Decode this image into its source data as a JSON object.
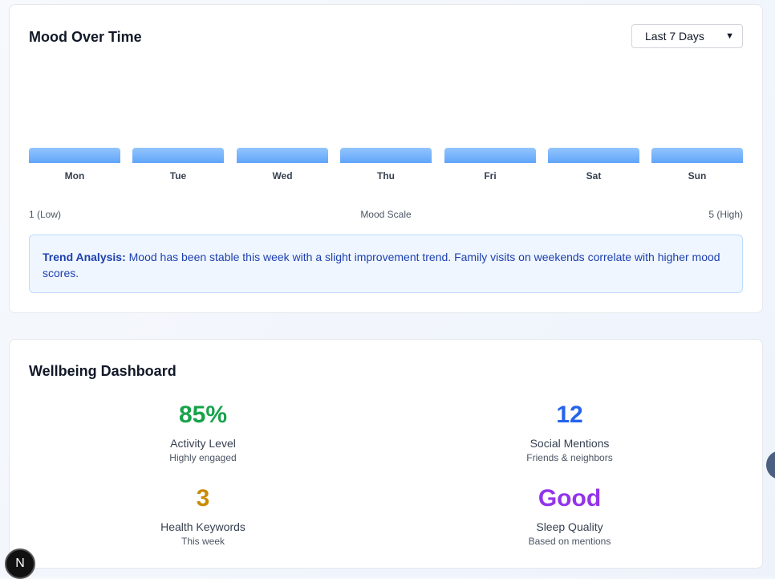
{
  "mood_card": {
    "title": "Mood Over Time",
    "range_select": {
      "value": "Last 7 Days"
    },
    "days": [
      "Mon",
      "Tue",
      "Wed",
      "Thu",
      "Fri",
      "Sat",
      "Sun"
    ],
    "scale": {
      "low": "1 (Low)",
      "mid": "Mood Scale",
      "high": "5 (High)"
    },
    "trend": {
      "label": "Trend Analysis:",
      "text": "Mood has been stable this week with a slight improvement trend. Family visits on weekends correlate with higher mood scores."
    }
  },
  "wellbeing": {
    "title": "Wellbeing Dashboard",
    "metrics": [
      {
        "value": "85%",
        "label": "Activity Level",
        "sub": "Highly engaged",
        "color": "#16a34a"
      },
      {
        "value": "12",
        "label": "Social Mentions",
        "sub": "Friends & neighbors",
        "color": "#2563eb"
      },
      {
        "value": "3",
        "label": "Health Keywords",
        "sub": "This week",
        "color": "#ca8a04"
      },
      {
        "value": "Good",
        "label": "Sleep Quality",
        "sub": "Based on mentions",
        "color": "#9333ea"
      }
    ]
  },
  "fab": {
    "label": "N"
  }
}
